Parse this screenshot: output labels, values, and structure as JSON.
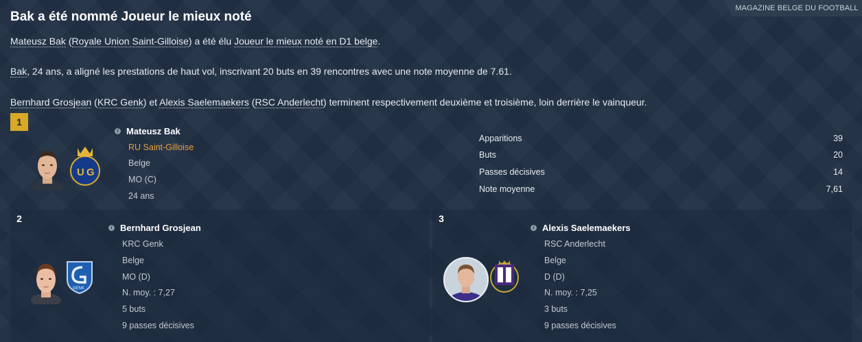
{
  "source": "MAGAZINE BELGE DU FOOTBALL",
  "title": "Bak a été nommé Joueur le mieux noté",
  "para1": {
    "p1": "Mateusz Bak",
    "p2": " (",
    "p3": "Royale Union Saint-Gilloise",
    "p4": ") a été élu ",
    "p5": "Joueur le mieux noté en D1 belge",
    "p6": "."
  },
  "para2": {
    "p1": "Bak",
    "p2": ", 24 ans, a aligné les prestations de haut vol, inscrivant 20 buts en 39 rencontres avec une note moyenne de 7.61."
  },
  "para3": {
    "p1": "Bernhard Grosjean",
    "p2": " (",
    "p3": "KRC Genk",
    "p4": ") et ",
    "p5": "Alexis Saelemaekers",
    "p6": " (",
    "p7": "RSC Anderlecht",
    "p8": ") terminent respectivement deuxième et troisième, loin derrière le vainqueur."
  },
  "winner": {
    "rank": "1",
    "name": "Mateusz Bak",
    "club": "RU Saint-Gilloise",
    "nationality": "Belge",
    "position": "MO (C)",
    "age": "24 ans",
    "club_color": "#e9a33a",
    "stats": [
      {
        "label": "Apparitions",
        "value": "39"
      },
      {
        "label": "Buts",
        "value": "20"
      },
      {
        "label": "Passes décisives",
        "value": "14"
      },
      {
        "label": "Note moyenne",
        "value": "7,61"
      }
    ]
  },
  "second": {
    "rank": "2",
    "name": "Bernhard Grosjean",
    "club": "KRC Genk",
    "nationality": "Belge",
    "position": "MO (D)",
    "rating": "N. moy. : 7,27",
    "goals": "5 buts",
    "assists": "9 passes décisives"
  },
  "third": {
    "rank": "3",
    "name": "Alexis Saelemaekers",
    "club": "RSC Anderlecht",
    "nationality": "Belge",
    "position": "D (D)",
    "rating": "N. moy. : 7,25",
    "goals": "3 buts",
    "assists": "9 passes décisives"
  },
  "colors": {
    "background": "#223044",
    "rank_gold": "#d8a928",
    "text": "#e9edf2"
  }
}
